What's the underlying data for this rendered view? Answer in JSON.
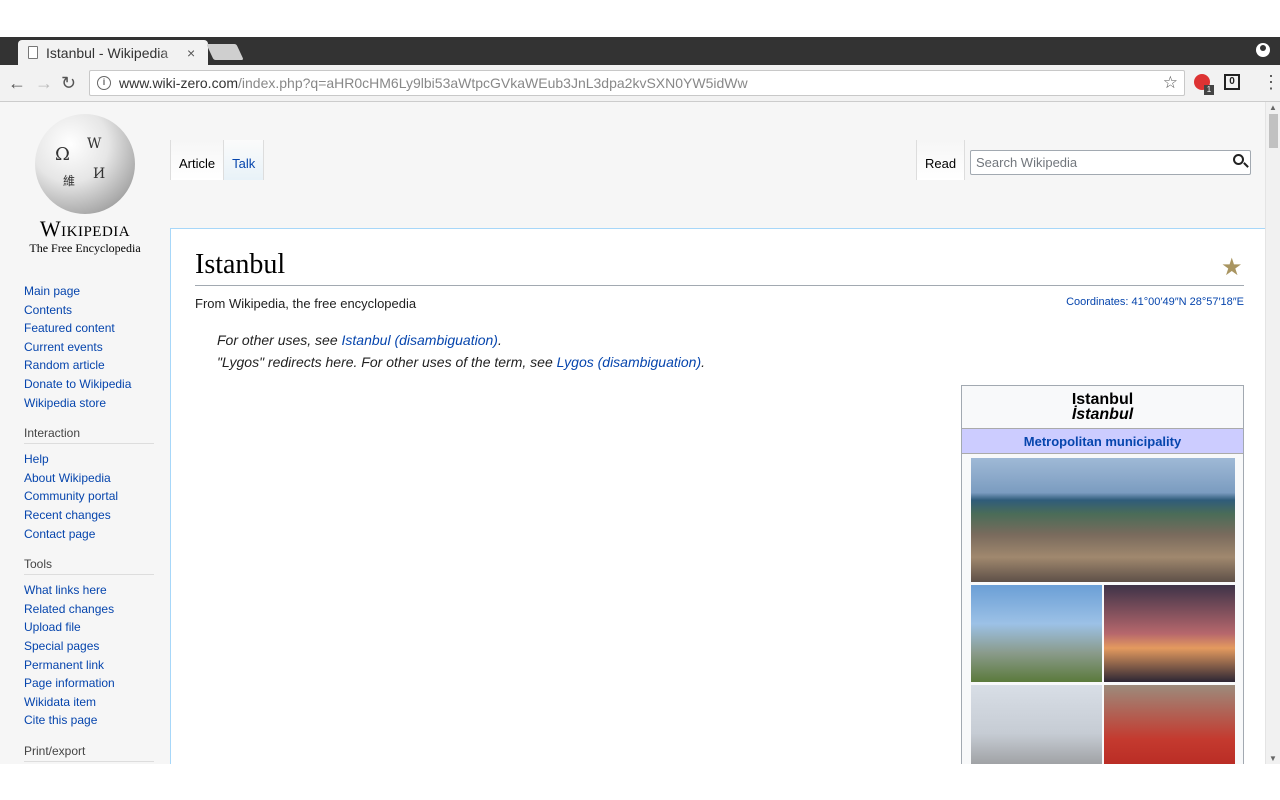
{
  "browser": {
    "tab_title": "Istanbul - Wikipedia",
    "tab_close": "×",
    "url_domain": "www.wiki-zero.com",
    "url_path": "/index.php?q=aHR0cHM6Ly9lbi53aWtpcGVkaWEub3JnL3dpa2kvSXN0YW5idWw",
    "info_glyph": "i",
    "back_glyph": "←",
    "forward_glyph": "→",
    "reload_glyph": "↻",
    "star_glyph": "☆",
    "ext_badge": "1",
    "ext2_label": "0",
    "menu_glyph": "⋮"
  },
  "logo": {
    "wordmark": "Wikipedia",
    "tagline": "The Free Encyclopedia"
  },
  "sidebar": {
    "nav": [
      "Main page",
      "Contents",
      "Featured content",
      "Current events",
      "Random article",
      "Donate to Wikipedia",
      "Wikipedia store"
    ],
    "interaction_heading": "Interaction",
    "interaction": [
      "Help",
      "About Wikipedia",
      "Community portal",
      "Recent changes",
      "Contact page"
    ],
    "tools_heading": "Tools",
    "tools": [
      "What links here",
      "Related changes",
      "Upload file",
      "Special pages",
      "Permanent link",
      "Page information",
      "Wikidata item",
      "Cite this page"
    ],
    "print_heading": "Print/export"
  },
  "tabs": {
    "article": "Article",
    "talk": "Talk",
    "read": "Read"
  },
  "search": {
    "placeholder": "Search Wikipedia"
  },
  "article": {
    "title": "Istanbul",
    "from": "From Wikipedia, the free encyclopedia",
    "coords_label": "Coordinates:",
    "coords_value": "41°00′49″N 28°57′18″E",
    "hatnote1_pre": "For other uses, see ",
    "hatnote1_link": "Istanbul (disambiguation)",
    "hatnote1_post": ".",
    "hatnote2_pre": "\"Lygos\" redirects here. For other uses of the term, see ",
    "hatnote2_link": "Lygos (disambiguation)",
    "hatnote2_post": "."
  },
  "infobox": {
    "title": "Istanbul",
    "subtitle": "İstanbul",
    "type": "Metropolitan municipality"
  },
  "colors": {
    "link": "#0645ad",
    "content_border": "#a7d7f9",
    "infobox_header": "#ccccff"
  }
}
